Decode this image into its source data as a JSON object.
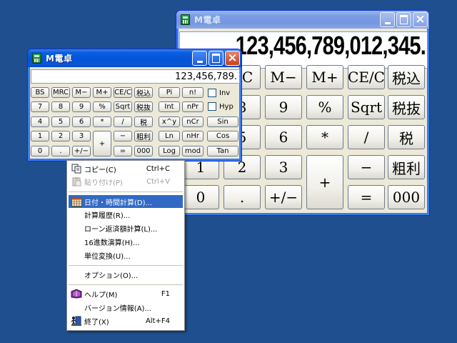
{
  "back_window": {
    "title": "M電卓",
    "display": "123,456,789,012,345.",
    "buttons": [
      "RC",
      "M−",
      "M+",
      "CE/C",
      "税込",
      "8",
      "9",
      "%",
      "Sqrt",
      "税抜",
      "5",
      "6",
      "*",
      "/",
      "税",
      "1",
      "2",
      "3",
      "+",
      "−",
      "粗利",
      "0",
      ".",
      "+/−",
      "=",
      "000"
    ]
  },
  "front_window": {
    "title": "M電卓",
    "display": "123,456,789.",
    "buttons": [
      "BS",
      "MRC",
      "M−",
      "M+",
      "CE/C",
      "税込",
      "Pi",
      "n!",
      "7",
      "8",
      "9",
      "%",
      "Sqrt",
      "税抜",
      "Int",
      "nPr",
      "Sin",
      "4",
      "5",
      "6",
      "*",
      "/",
      "税",
      "x^y",
      "nCr",
      "1",
      "2",
      "3",
      "+",
      "−",
      "粗利",
      "Ln",
      "nHr",
      "Cos",
      "0",
      ".",
      "+/−",
      "=",
      "000",
      "Log",
      "mod",
      "Tan"
    ],
    "checkboxes": [
      "Inv",
      "Hyp"
    ]
  },
  "menu": {
    "items": [
      {
        "label": "コピー(C)",
        "shortcut": "Ctrl+C",
        "icon": "copy-icon"
      },
      {
        "label": "貼り付け(P)",
        "shortcut": "Ctrl+V",
        "icon": "paste-icon",
        "disabled": true
      },
      {
        "label": "日付・時間計算(D)...",
        "shortcut": "",
        "icon": "calendar-icon",
        "highlighted": true
      },
      {
        "label": "計算履歴(R)...",
        "shortcut": ""
      },
      {
        "label": "ローン返済額計算(L)...",
        "shortcut": ""
      },
      {
        "label": "16進数演算(H)...",
        "shortcut": ""
      },
      {
        "label": "単位変換(U)...",
        "shortcut": ""
      },
      {
        "label": "オプション(O)...",
        "shortcut": ""
      },
      {
        "label": "ヘルプ(M)",
        "shortcut": "F1",
        "icon": "help-book-icon"
      },
      {
        "label": "バージョン情報(A)...",
        "shortcut": ""
      },
      {
        "label": "終了(X)",
        "shortcut": "Alt+F4",
        "icon": "exit-icon"
      }
    ]
  },
  "colors": {
    "desktop": "#1f4f8f",
    "titlebar_active": "#0453d8",
    "menu_highlight": "#316ac5"
  }
}
